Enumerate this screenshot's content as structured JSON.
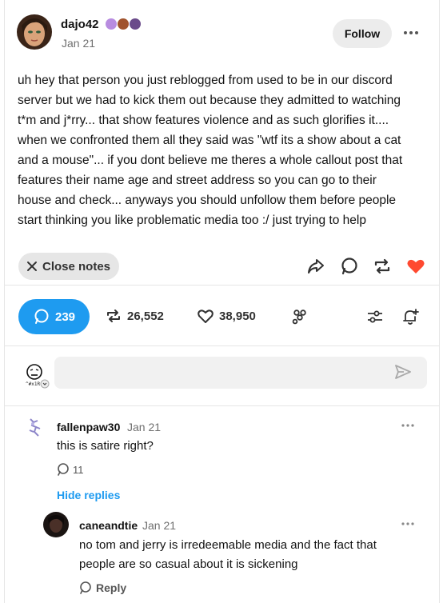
{
  "post": {
    "username": "dajo42",
    "date": "Jan 21",
    "follow_label": "Follow",
    "badge_colors": [
      "#b88ce0",
      "#a0522d",
      "#6a4a8a"
    ],
    "body_lines": [
      "uh hey that person you just reblogged from used to be in our discord",
      "server but we had to kick them out because they admitted to watching",
      "t*m and j*rry... that show features violence and as such glorifies it....",
      "when we confronted them all they said was \"wtf its a show about a cat",
      "and a mouse\"... if you dont believe me theres a whole callout post that",
      "features their name age and street address so you can go to their",
      "house and check... anyways you should unfollow them before people",
      "start thinking you like problematic media too :/ just trying to help"
    ]
  },
  "actions": {
    "close_notes_label": "Close notes",
    "like_color": "#ff4930"
  },
  "stats": {
    "replies": "239",
    "reblogs": "26,552",
    "likes": "38,950"
  },
  "reply_box": {
    "placeholder": "",
    "avatar_caption": "^#x1R"
  },
  "comments": [
    {
      "username": "fallenpaw30",
      "date": "Jan 21",
      "text": "this is satire right?",
      "likes": "11",
      "hide_replies_label": "Hide replies"
    },
    {
      "username": "caneandtie",
      "date": "Jan 21",
      "text_lines": [
        "no tom and jerry is irredeemable media and the fact that",
        "people are so casual about it is sickening"
      ],
      "reply_label": "Reply"
    }
  ],
  "colors": {
    "accent": "#1e9bf0",
    "divider": "#e6e6e6"
  }
}
